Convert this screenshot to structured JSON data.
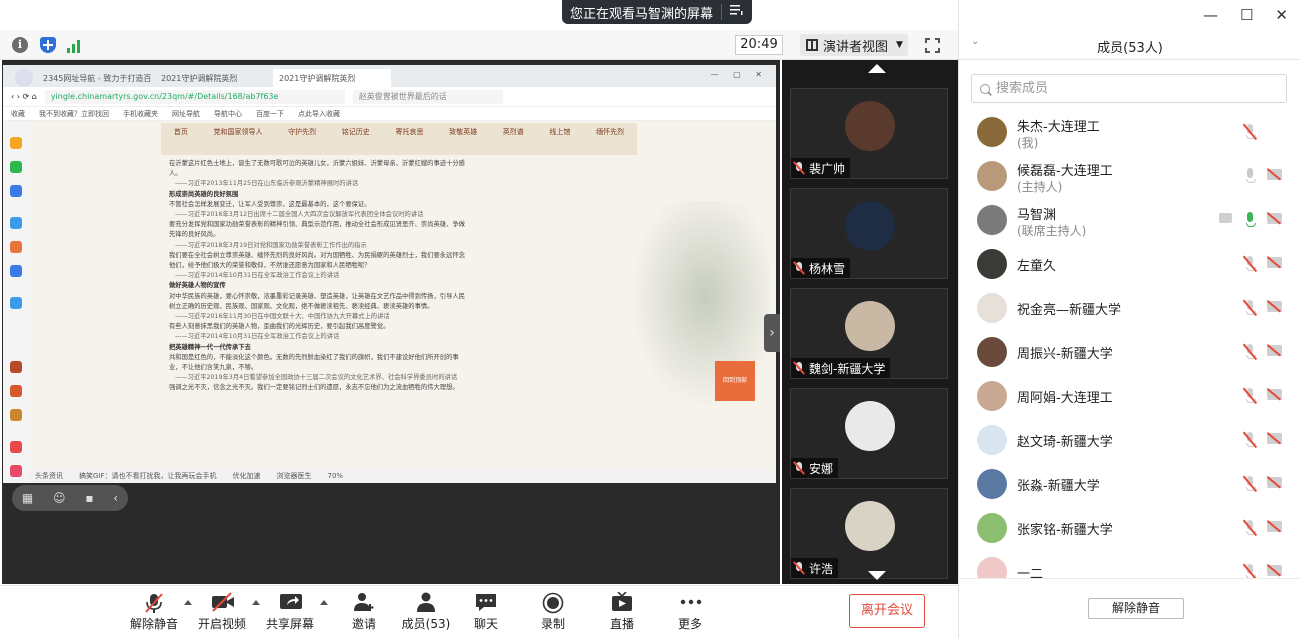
{
  "banner": {
    "text": "您正在观看马智渊的屏幕",
    "menu_icon": "list-icon"
  },
  "toolbar": {
    "time": "20:49",
    "view_label": "演讲者视图"
  },
  "browser": {
    "tabs": [
      "2345网址导航 - 致力于打造百",
      "2021守护调解院英烈",
      "2021守护调解院英烈"
    ],
    "url": "yingle.chinamartyrs.gov.cn/23qm/#/Details/168/ab7f63e",
    "search_placeholder": "赵英俊曾被世界最后的话",
    "bookmarks": [
      "收藏",
      "我不到收藏？立即找回",
      "手机收藏夹",
      "网址导航",
      "导航中心",
      "百度一下",
      "点此导入收藏"
    ],
    "nav": [
      "首页",
      "党和国家领导人",
      "守护先烈",
      "铭记历史",
      "寄托哀思",
      "致敬英雄",
      "英烈谱",
      "线上馆",
      "缅怀先烈"
    ],
    "paragraphs": [
      {
        "cls": "",
        "text": "在沂蒙这片红色土地上，诞生了无数可歌可泣的英雄儿女，沂蒙六姐妹、沂蒙母亲、沂蒙红嫂的事迹十分感人。"
      },
      {
        "cls": "quote",
        "text": "——习近平2013年11月25日在山东临沂参观沂蒙精神展时的讲话"
      },
      {
        "cls": "bold",
        "text": "形成崇尚英雄的良好氛围"
      },
      {
        "cls": "",
        "text": "不管社会怎样发展变迁，让军人受到尊崇，这是最基本的，这个要保证。"
      },
      {
        "cls": "quote",
        "text": "——习近平2016年3月12日出席十二届全国人大四次会议解放军代表团全体会议时的讲话"
      },
      {
        "cls": "",
        "text": "要充分发挥党和国家功勋荣誉表彰的精神引领、典型示范作用，推动全社会形成见贤思齐、崇尚英雄、争做先锋的良好风尚。"
      },
      {
        "cls": "quote",
        "text": "——习近平2018年3月19日对党和国家功勋荣誉表彰工作作出的指示"
      },
      {
        "cls": "",
        "text": "我们要在全社会树立尊崇英雄、缅怀先烈的良好风尚。对为国牺牲、为民捐躯的英雄烈士，我们要永远怀念他们，给予他们极大的荣誉和敬仰，不然谁还愿意为国家和人民牺牲呢？"
      },
      {
        "cls": "quote",
        "text": "——习近平2014年10月31日在全军政治工作会议上的讲话"
      },
      {
        "cls": "bold",
        "text": "做好英雄人物的宣传"
      },
      {
        "cls": "",
        "text": "对中华民族的英雄，要心怀崇敬，浓墨重彩记录英雄、塑造英雄，让英雄在文艺作品中得到传扬，引导人民树立正确的历史观、民族观、国家观、文化观，绝不做亵渎祖先、亵渎经典、亵渎英雄的事情。"
      },
      {
        "cls": "quote",
        "text": "——习近平2016年11月30日在中国文联十大、中国作协九大开幕式上的讲话"
      },
      {
        "cls": "",
        "text": "有些人刻意抹黑我们的英雄人物，歪曲我们的光辉历史，要引起我们高度警觉。"
      },
      {
        "cls": "quote",
        "text": "——习近平2014年10月31日在全军政治工作会议上的讲话"
      },
      {
        "cls": "bold",
        "text": "把英雄精神一代一代传承下去"
      },
      {
        "cls": "",
        "text": "共和国是红色的，不能淡化这个颜色。无数的先烈鲜血染红了我们的旗帜，我们不建设好他们所开创的事业，不让他们含笑九泉，不够。"
      },
      {
        "cls": "quote",
        "text": "——习近平2019年3月4日看望参加全国政协十三届二次会议的文化艺术界、社会科学界委员时的讲话"
      },
      {
        "cls": "",
        "text": "强调之光不灭，信念之光不灭。我们一定要铭记烈士们的遗愿，永志不忘他们为之流血牺牲的伟大理想。"
      }
    ],
    "back_top_label": "回到顶部",
    "status_items": [
      "头条资讯",
      "搞笑GIF：请也不看打扰我，让我再玩会手机",
      "优化加速",
      "浏览器医生"
    ],
    "zoom": "70%"
  },
  "video_tiles": [
    {
      "name": "裴广帅",
      "avatar_color": "#5b3a2e"
    },
    {
      "name": "杨林雪",
      "avatar_color": "#1e2c44"
    },
    {
      "name": "魏剑-新疆大学",
      "avatar_color": "#c9b8a4"
    },
    {
      "name": "安娜",
      "avatar_color": "#e9e9e9"
    },
    {
      "name": "许浩",
      "avatar_color": "#d9d3c6"
    }
  ],
  "controls": {
    "unmute": "解除静音",
    "video": "开启视频",
    "share": "共享屏幕",
    "invite": "邀请",
    "members": "成员(53)",
    "chat": "聊天",
    "record": "录制",
    "live": "直播",
    "more": "更多",
    "leave": "离开会议"
  },
  "panel": {
    "title": "成员(53人)",
    "search_placeholder": "搜索成员",
    "unmute_all": "解除静音",
    "members": [
      {
        "name": "朱杰-大连理工",
        "role": "(我)",
        "avatar": "#8a6a3a",
        "mic": "muted",
        "cam": false
      },
      {
        "name": "候磊磊-大连理工",
        "role": "(主持人)",
        "avatar": "#b89a7a",
        "mic": "grey",
        "cam": true
      },
      {
        "name": "马智渊",
        "role": "(联席主持人)",
        "avatar": "#7a7a7a",
        "mic": "green",
        "cam": true,
        "share": true
      },
      {
        "name": "左童久",
        "role": "",
        "avatar": "#3c3a36",
        "mic": "muted",
        "cam": true
      },
      {
        "name": "祝金亮—新疆大学",
        "role": "",
        "avatar": "#e6e0d8",
        "mic": "muted",
        "cam": true
      },
      {
        "name": "周振兴-新疆大学",
        "role": "",
        "avatar": "#6a4a3a",
        "mic": "muted",
        "cam": true
      },
      {
        "name": "周阿娟-大连理工",
        "role": "",
        "avatar": "#c8a890",
        "mic": "muted",
        "cam": true
      },
      {
        "name": "赵文琦-新疆大学",
        "role": "",
        "avatar": "#d8e4f0",
        "mic": "muted",
        "cam": true
      },
      {
        "name": "张淼-新疆大学",
        "role": "",
        "avatar": "#5a7aa4",
        "mic": "muted",
        "cam": true
      },
      {
        "name": "张家铭-新疆大学",
        "role": "",
        "avatar": "#8cc070",
        "mic": "muted",
        "cam": true
      },
      {
        "name": "一二",
        "role": "",
        "avatar": "#f0c8c8",
        "mic": "muted",
        "cam": true
      }
    ]
  }
}
